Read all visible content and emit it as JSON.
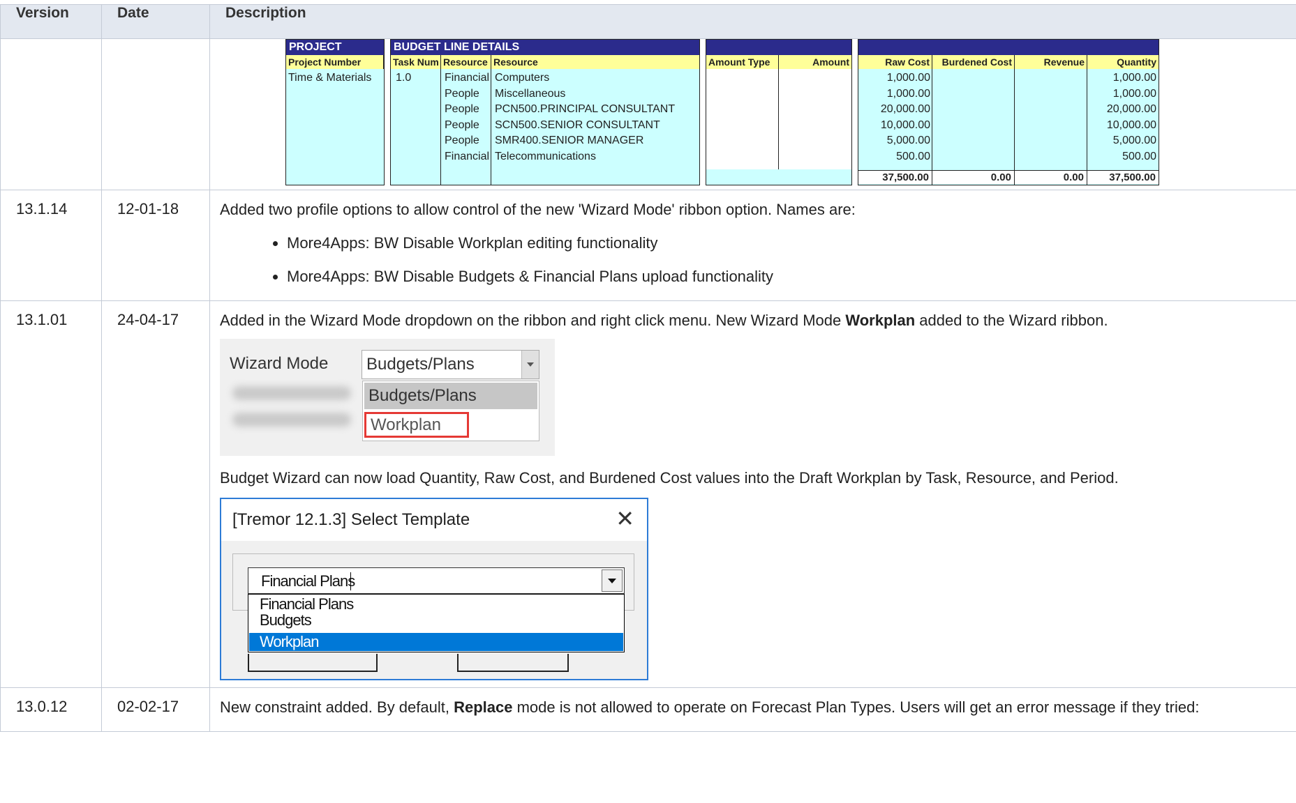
{
  "table": {
    "headers": {
      "version": "Version",
      "date": "Date",
      "description": "Description"
    }
  },
  "budget_sheet": {
    "project_bar": "PROJECT",
    "budget_bar": "BUDGET LINE DETAILS",
    "headers": {
      "project_number": "Project Number",
      "task_num": "Task Num",
      "resource_type": "Resource",
      "resource": "Resource",
      "amount_type": "Amount Type",
      "amount": "Amount",
      "raw_cost": "Raw Cost",
      "burdened_cost": "Burdened Cost",
      "revenue": "Revenue",
      "quantity": "Quantity"
    },
    "project_value": "Time & Materials",
    "task_value": "1.0",
    "rows": [
      {
        "type": "Financial",
        "resource": "Computers",
        "raw": "1,000.00",
        "qty": "1,000.00"
      },
      {
        "type": "People",
        "resource": "Miscellaneous",
        "raw": "1,000.00",
        "qty": "1,000.00"
      },
      {
        "type": "People",
        "resource": "PCN500.PRINCIPAL CONSULTANT",
        "raw": "20,000.00",
        "qty": "20,000.00"
      },
      {
        "type": "People",
        "resource": "SCN500.SENIOR CONSULTANT",
        "raw": "10,000.00",
        "qty": "10,000.00"
      },
      {
        "type": "People",
        "resource": "SMR400.SENIOR MANAGER",
        "raw": "5,000.00",
        "qty": "5,000.00"
      },
      {
        "type": "Financial",
        "resource": "Telecommunications",
        "raw": "500.00",
        "qty": "500.00"
      }
    ],
    "totals": {
      "raw": "37,500.00",
      "burdened": "0.00",
      "revenue": "0.00",
      "qty": "37,500.00"
    },
    "colors": {
      "fill": "#ccffff",
      "header": "#ffff99",
      "bar": "#2b2b8c",
      "flag": "#e00000"
    }
  },
  "entries": [
    {
      "version": "13.1.14",
      "date": "12-01-18",
      "text": "Added two profile options to allow control of the new 'Wizard Mode' ribbon option.  Names are:",
      "bullets": [
        "More4Apps: BW Disable Workplan editing functionality",
        "More4Apps: BW Disable Budgets & Financial Plans upload functionality"
      ]
    },
    {
      "version": "13.1.01",
      "date": "24-04-17",
      "text_a": "Added in the Wizard Mode dropdown on the ribbon and right click menu.  New Wizard Mode ",
      "text_bold": "Workplan",
      "text_b": " added to the Wizard ribbon.",
      "wizard_image": {
        "label": "Wizard Mode",
        "selected": "Budgets/Plans",
        "options": [
          "Budgets/Plans",
          "Workplan"
        ]
      },
      "text2": "Budget Wizard can now load Quantity, Raw Cost, and Burdened Cost values into the Draft Workplan by Task, Resource, and Period.",
      "dialog": {
        "title": "[Tremor 12.1.3] Select Template",
        "close": "✕",
        "value": "Financial Plans",
        "options": [
          "Financial Plans",
          "Budgets",
          "Workplan"
        ]
      }
    },
    {
      "version": "13.0.12",
      "date": "02-02-17",
      "text_a": "New constraint added. By default, ",
      "text_bold": "Replace",
      "text_b": " mode is not allowed to operate on Forecast Plan Types. Users will get an error message if they tried:"
    }
  ]
}
